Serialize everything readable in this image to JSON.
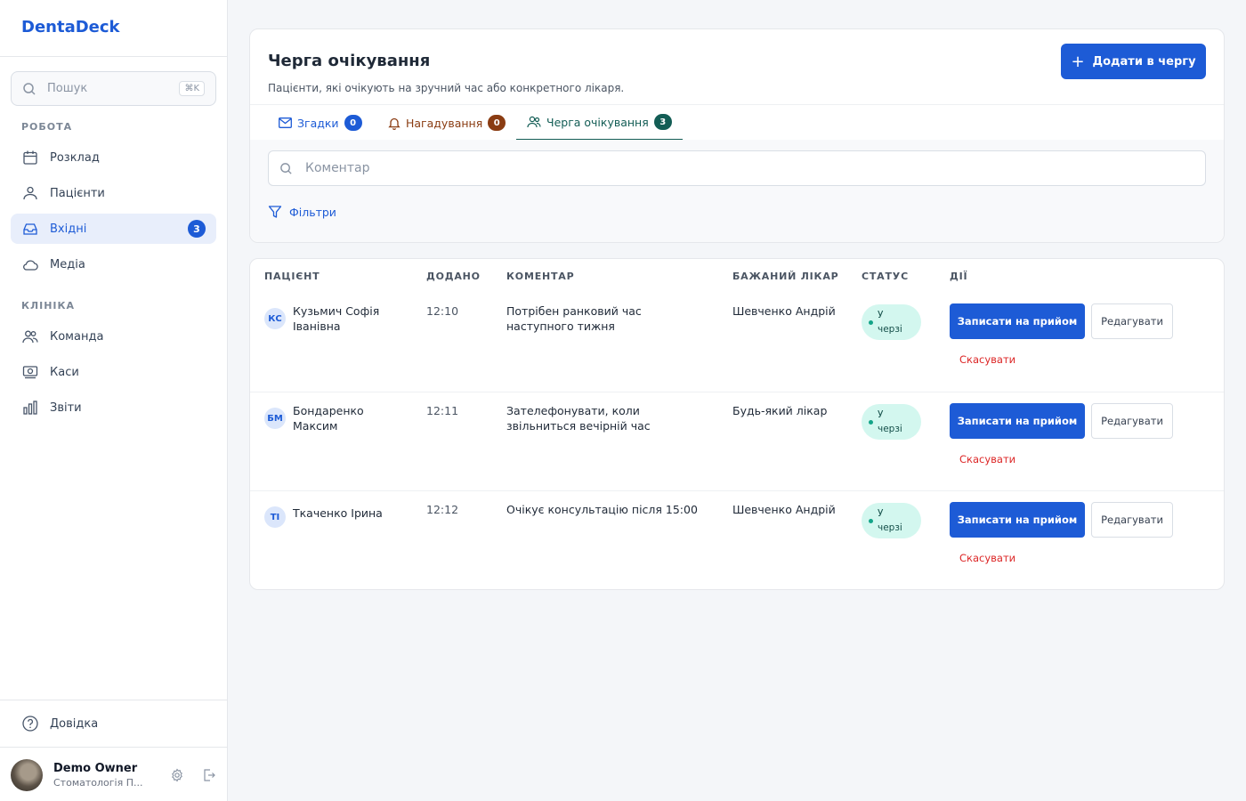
{
  "app": {
    "brand": "DentaDeck"
  },
  "sidebar": {
    "search": {
      "placeholder": "Пошук",
      "shortcut": "⌘K"
    },
    "sections": {
      "work": "РОБОТА",
      "clinic": "КЛІНІКА"
    },
    "items": [
      {
        "label": "Розклад",
        "icon": "calendar-icon"
      },
      {
        "label": "Пацієнти",
        "icon": "patients-icon"
      },
      {
        "label": "Вхідні",
        "icon": "inbox-icon",
        "badge": "3",
        "active": true
      },
      {
        "label": "Медіа",
        "icon": "cloud-icon"
      },
      {
        "label": "Команда",
        "icon": "team-icon"
      },
      {
        "label": "Каси",
        "icon": "cash-icon"
      },
      {
        "label": "Звіти",
        "icon": "bar-chart-icon"
      }
    ],
    "help": "Довідка",
    "user": {
      "name": "Demo Owner",
      "org": "Стоматологія П..."
    }
  },
  "header": {
    "title": "Черга очікування",
    "subtitle": "Пацієнти, які очікують на зручний час або конкретного лікаря.",
    "add_button": "Додати в чергу"
  },
  "tabs": [
    {
      "label": "Згадки",
      "count": "0",
      "color": "#1d5bd6",
      "icon": "mail-icon"
    },
    {
      "label": "Нагадування",
      "count": "0",
      "color": "#8a3c12",
      "icon": "bell-icon"
    },
    {
      "label": "Черга очікування",
      "count": "3",
      "color": "#135d55",
      "icon": "users-icon",
      "active": true
    }
  ],
  "filters": {
    "comment_placeholder": "Коментар",
    "filters_label": "Фільтри"
  },
  "table": {
    "columns": [
      "ПАЦІЄНТ",
      "ДОДАНО",
      "КОМЕНТАР",
      "БАЖАНИЙ ЛІКАР",
      "СТАТУС",
      "ДІЇ"
    ],
    "rows": [
      {
        "initials": "КС",
        "patient": "Кузьмич Софія Іванівна",
        "added": "12:10",
        "comment": "Потрібен ранковий час наступного тижня",
        "doctor": "Шевченко Андрій",
        "status": "У черзі"
      },
      {
        "initials": "БМ",
        "patient": "Бондаренко Максим",
        "added": "12:11",
        "comment": "Зателефонувати, коли звільниться вечірній час",
        "doctor": "Будь-який лікар",
        "status": "У черзі"
      },
      {
        "initials": "ТІ",
        "patient": "Ткаченко Ірина",
        "added": "12:12",
        "comment": "Очікує консультацію після 15:00",
        "doctor": "Шевченко Андрій",
        "status": "У черзі"
      }
    ],
    "actions": {
      "book": "Записати на прийом",
      "edit": "Редагувати",
      "cancel": "Скасувати"
    }
  },
  "colors": {
    "accent": "#1d5bd6",
    "status_bg": "#d3f7ef",
    "danger": "#dc2626"
  }
}
